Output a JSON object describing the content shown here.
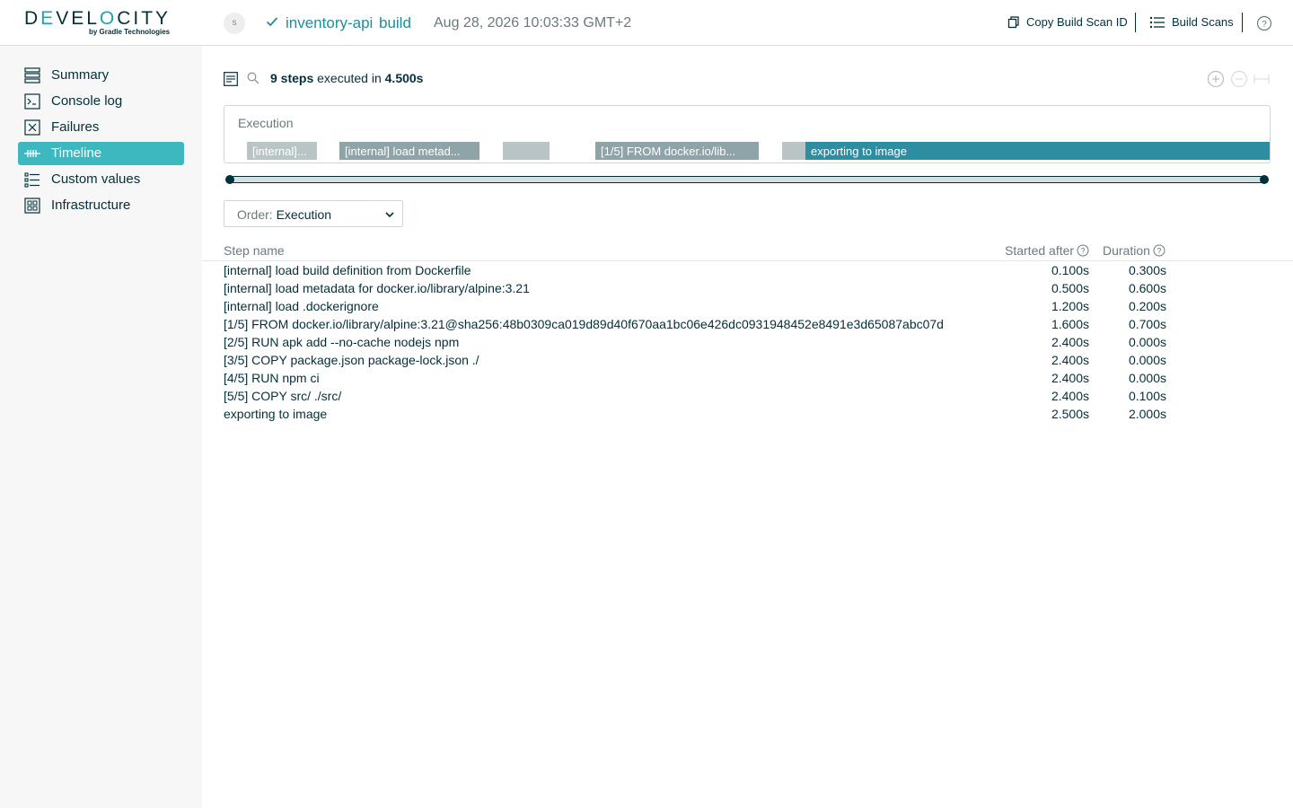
{
  "header": {
    "logo_text_a": "D",
    "logo_text_accent": "E",
    "logo_text_b": "VEL",
    "logo_text_accent2": "O",
    "logo_text_c": "CITY",
    "logo_sub": "by Gradle Technologies",
    "avatar_initial": "s",
    "project": "inventory-api",
    "task": "build",
    "timestamp": "Aug 28, 2026 10:03:33 GMT+2",
    "copy_scan_label": "Copy Build Scan ID",
    "build_scans_label": "Build Scans",
    "accent_color": "#1c8f96"
  },
  "sidebar": {
    "items": [
      {
        "label": "Summary",
        "icon": "summary-icon",
        "active": false
      },
      {
        "label": "Console log",
        "icon": "console-icon",
        "active": false
      },
      {
        "label": "Failures",
        "icon": "failures-icon",
        "active": false
      },
      {
        "label": "Timeline",
        "icon": "timeline-icon",
        "active": true
      },
      {
        "label": "Custom values",
        "icon": "custom-values-icon",
        "active": false
      },
      {
        "label": "Infrastructure",
        "icon": "infrastructure-icon",
        "active": false
      }
    ],
    "active_color": "#3cb8be"
  },
  "main": {
    "summary_steps": "9 steps",
    "summary_mid": " executed in ",
    "summary_time": "4.500s",
    "execution_title": "Execution",
    "bars": [
      {
        "label": "[internal]...",
        "tone": "gray"
      },
      {
        "label": "[internal] load metad...",
        "tone": "slate"
      },
      {
        "label": "",
        "tone": "gray"
      },
      {
        "label": "[1/5] FROM docker.io/lib...",
        "tone": "slate"
      },
      {
        "label": "",
        "tone": "gray"
      },
      {
        "label": "exporting to image",
        "tone": "teal"
      }
    ],
    "order_label": "Order: ",
    "order_value": "Execution",
    "columns": {
      "name": "Step name",
      "started": "Started after",
      "duration": "Duration"
    },
    "steps": [
      {
        "name": "[internal] load build definition from Dockerfile",
        "started": "0.100s",
        "duration": "0.300s"
      },
      {
        "name": "[internal] load metadata for docker.io/library/alpine:3.21",
        "started": "0.500s",
        "duration": "0.600s"
      },
      {
        "name": "[internal] load .dockerignore",
        "started": "1.200s",
        "duration": "0.200s"
      },
      {
        "name": "[1/5] FROM docker.io/library/alpine:3.21@sha256:48b0309ca019d89d40f670aa1bc06e426dc0931948452e8491e3d65087abc07d",
        "started": "1.600s",
        "duration": "0.700s"
      },
      {
        "name": "[2/5] RUN apk add --no-cache nodejs npm",
        "started": "2.400s",
        "duration": "0.000s"
      },
      {
        "name": "[3/5] COPY package.json package-lock.json ./",
        "started": "2.400s",
        "duration": "0.000s"
      },
      {
        "name": "[4/5] RUN npm ci",
        "started": "2.400s",
        "duration": "0.000s"
      },
      {
        "name": "[5/5] COPY src/ ./src/",
        "started": "2.400s",
        "duration": "0.100s"
      },
      {
        "name": "exporting to image",
        "started": "2.500s",
        "duration": "2.000s"
      }
    ]
  }
}
